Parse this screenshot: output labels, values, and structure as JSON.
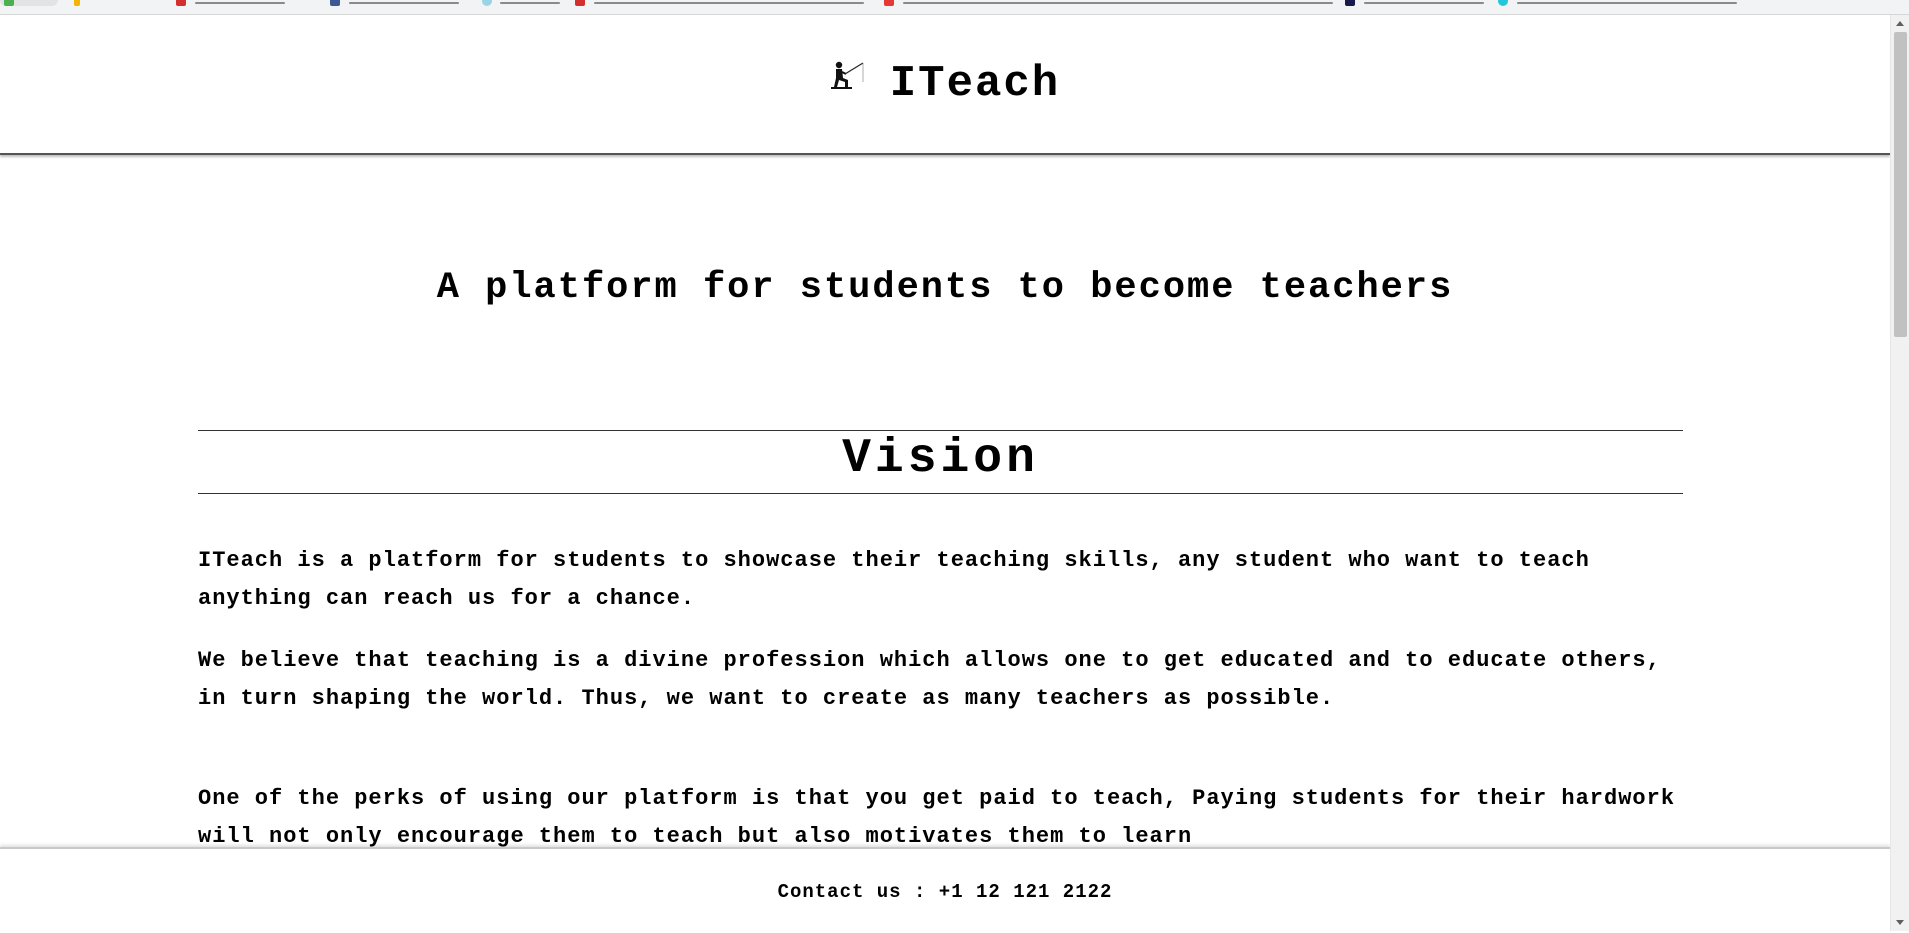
{
  "header": {
    "brand": "ITeach",
    "logo_icon": "fishing-person-icon"
  },
  "main": {
    "tagline": "A platform for students to become teachers",
    "vision_title": "Vision",
    "paragraphs": [
      "ITeach is a platform for students to showcase their teaching skills, any student who want to teach anything can reach us for a chance.",
      "We believe that teaching is a divine profession which allows one to get educated and to educate others, in turn shaping the world. Thus, we want to create as many teachers as possible.",
      "One of the perks of using our platform is that you get paid to teach, Paying students for their hardwork will not only encourage them to teach but also motivates them to learn"
    ]
  },
  "footer": {
    "contact": "Contact us : +1 12 121 2122"
  },
  "colors": {
    "text": "#000000",
    "background": "#ffffff",
    "header_rule": "#555555"
  }
}
